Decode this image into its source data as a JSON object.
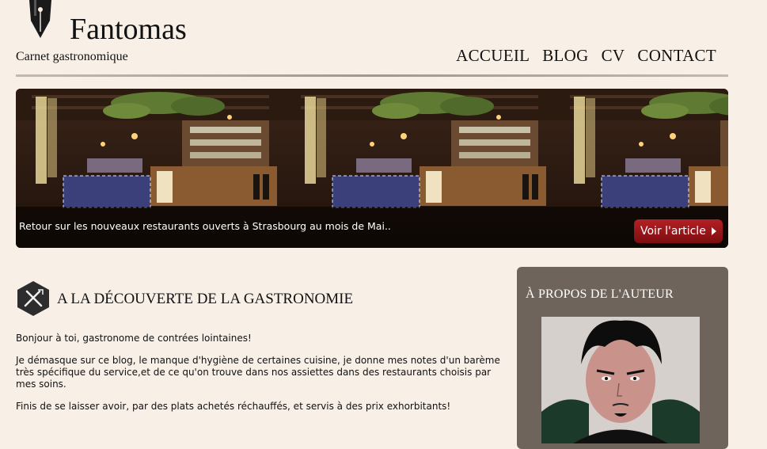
{
  "site": {
    "title": "Fantomas",
    "tagline": "Carnet gastronomique"
  },
  "nav": {
    "home": "ACCUEIL",
    "blog": "BLOG",
    "cv": "CV",
    "contact": "CONTACT"
  },
  "slider": {
    "caption": "Retour sur les nouveaux restaurants ouverts à Strasbourg au mois de Mai..",
    "button": "Voir l'article",
    "button_color": "#9e1a1d"
  },
  "section": {
    "title": "A LA DÉCOUVERTE DE LA GASTRONOMIE",
    "paragraphs": [
      "Bonjour à toi, gastronome de contrées lointaines!",
      "Je démasque sur ce blog, le manque d'hygiène de certaines cuisine, je donne mes notes d'un barème très spécifique du service,et de ce qu'on trouve dans nos assiettes dans des restaurants choisis par mes soins.",
      "Finis de se laisser avoir, par des plats achetés réchauffés, et servis à des prix exhorbitants!"
    ]
  },
  "sidebar": {
    "about_title": "À PROPOS DE L'AUTEUR"
  },
  "colors": {
    "background": "#f8efe7",
    "sidebar_panel": "#6e645c"
  }
}
